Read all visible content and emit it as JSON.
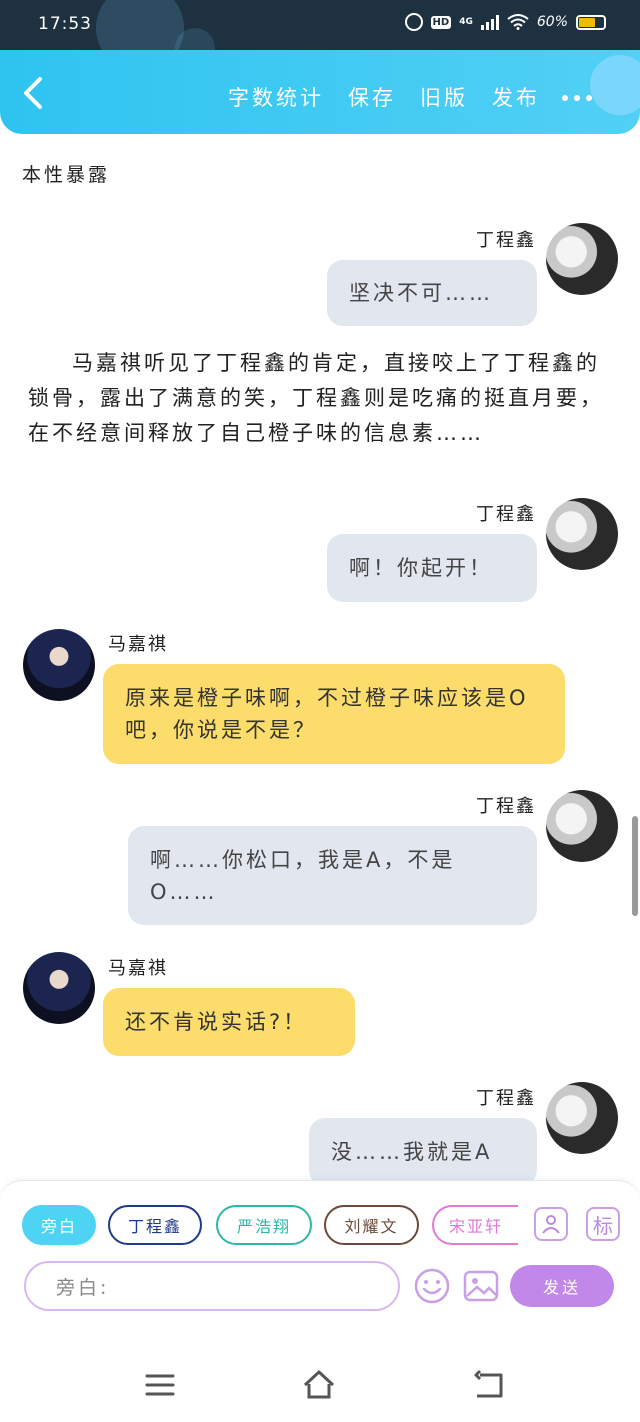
{
  "status_bar": {
    "time": "17:53",
    "hd": "HD",
    "network": "4G",
    "battery_text": "60%",
    "battery_level": 0.6
  },
  "header": {
    "actions": [
      "字数统计",
      "保存",
      "旧版",
      "发布"
    ]
  },
  "document": {
    "title": "本性暴露"
  },
  "messages": [
    {
      "speaker": "丁程鑫",
      "text": "坚决不可……"
    },
    {
      "narration": "马嘉祺听见了丁程鑫的肯定，直接咬上了丁程鑫的锁骨，露出了满意的笑，丁程鑫则是吃痛的挺直月要，在不经意间释放了自己橙子味的信息素……"
    },
    {
      "speaker": "丁程鑫",
      "text": "啊！你起开！"
    },
    {
      "speaker": "马嘉祺",
      "text": "原来是橙子味啊，不过橙子味应该是O吧，你说是不是？"
    },
    {
      "speaker": "丁程鑫",
      "text": "啊……你松口，我是A，不是O……"
    },
    {
      "speaker": "马嘉祺",
      "text": "还不肯说实话?！"
    },
    {
      "speaker": "丁程鑫",
      "text": "没……我就是A"
    }
  ],
  "composer": {
    "roles": [
      {
        "label": "旁白",
        "color": "#4fd3f4"
      },
      {
        "label": "丁程鑫",
        "color": "#1e3a8a"
      },
      {
        "label": "严浩翔",
        "color": "#2bb8a8"
      },
      {
        "label": "刘耀文",
        "color": "#6b4a3a"
      },
      {
        "label": "宋亚轩",
        "color": "#e07ad8"
      }
    ],
    "tag_button": "标",
    "input_placeholder": "旁白:",
    "send_label": "发送"
  }
}
